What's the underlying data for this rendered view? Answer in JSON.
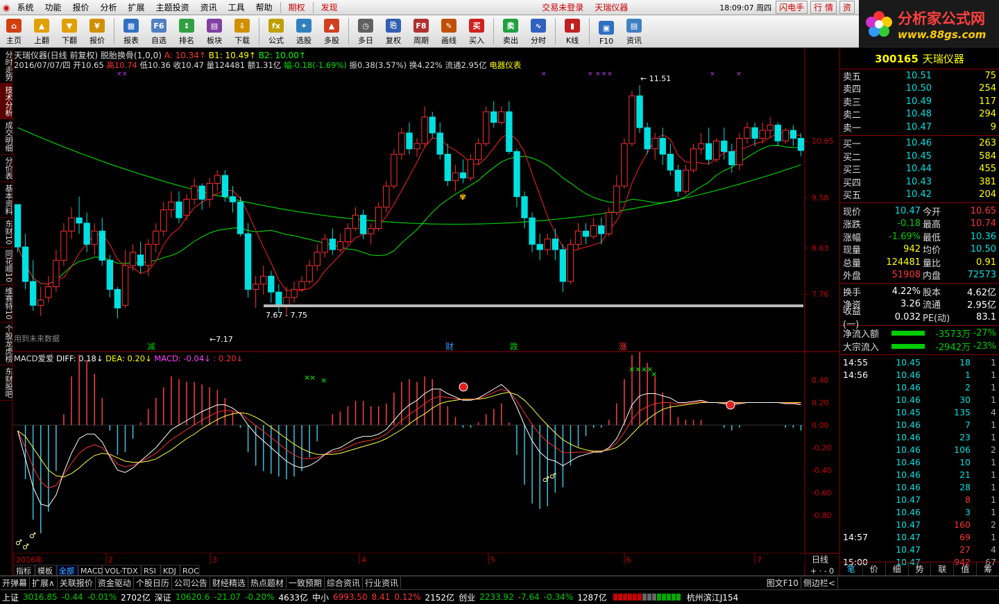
{
  "menu": {
    "items": [
      "系统",
      "功能",
      "报价",
      "分析",
      "扩展",
      "主题投资",
      "资讯",
      "工具",
      "帮助"
    ],
    "tab_qihuo": "期权",
    "tab_faxian": "发现",
    "login_status": "交易未登录",
    "stock_name_top": "天瑞仪器",
    "clock": "18:09:07 周四",
    "btn_flash": "闪电手",
    "btn_quote": "行 情",
    "btn_asset": "资"
  },
  "toolbar": [
    {
      "label": "主页",
      "icon": "home-icon",
      "color": "#d04010",
      "glyph": "⌂"
    },
    {
      "label": "上翻",
      "icon": "arrow-up-icon",
      "color": "#e0a000",
      "glyph": "▲"
    },
    {
      "label": "下翻",
      "icon": "arrow-down-icon",
      "color": "#e0a000",
      "glyph": "▼"
    },
    {
      "label": "报价",
      "icon": "price-icon",
      "color": "#d09000",
      "glyph": "¥"
    },
    {
      "label": "报表",
      "icon": "report-icon",
      "color": "#3070c0",
      "glyph": "▦"
    },
    {
      "label": "自选",
      "icon": "f6-icon",
      "color": "#5080c0",
      "glyph": "F6"
    },
    {
      "label": "排名",
      "icon": "rank-icon",
      "color": "#30a040",
      "glyph": "↕"
    },
    {
      "label": "板块",
      "icon": "sector-icon",
      "color": "#8040a0",
      "glyph": "▤"
    },
    {
      "label": "下载",
      "icon": "download-icon",
      "color": "#d09000",
      "glyph": "⇩"
    },
    {
      "label": "公式",
      "icon": "formula-icon",
      "color": "#c0a000",
      "glyph": "fx"
    },
    {
      "label": "选股",
      "icon": "pick-icon",
      "color": "#3080c0",
      "glyph": "✦"
    },
    {
      "label": "多股",
      "icon": "multi-icon",
      "color": "#d04020",
      "glyph": "▲"
    },
    {
      "label": "多日",
      "icon": "clock-icon",
      "color": "#606060",
      "glyph": "◷"
    },
    {
      "label": "复权",
      "icon": "restore-icon",
      "color": "#3060b0",
      "glyph": "⎘"
    },
    {
      "label": "周期",
      "icon": "f8-icon",
      "color": "#b03030",
      "glyph": "F8"
    },
    {
      "label": "画线",
      "icon": "draw-icon",
      "color": "#c05000",
      "glyph": "✎"
    },
    {
      "label": "买入",
      "icon": "buy-icon",
      "color": "#d02020",
      "glyph": "买"
    },
    {
      "label": "卖出",
      "icon": "sell-icon",
      "color": "#20a040",
      "glyph": "卖"
    },
    {
      "label": "分时",
      "icon": "intraday-icon",
      "color": "#3060c0",
      "glyph": "∿"
    },
    {
      "label": "K线",
      "icon": "kline-icon",
      "color": "#c02020",
      "glyph": "▮"
    },
    {
      "label": "F10",
      "icon": "f10-icon",
      "color": "#3070c0",
      "glyph": "▣"
    },
    {
      "label": "资讯",
      "icon": "news-icon",
      "color": "#4080c0",
      "glyph": "▤"
    }
  ],
  "logo": {
    "title": "分析家公式网",
    "url": "www.88gs.com"
  },
  "leftnav": [
    "分时走势",
    "技术分析",
    "成交明细",
    "分价表",
    "基本资料",
    "东财10",
    "同花顺10",
    "维赛特10",
    "个股龙虎榜",
    "东财股吧"
  ],
  "chart": {
    "header1": {
      "name": "天瑞仪器(日线 前复权)",
      "formula": "脱胎换骨(1,0,0)",
      "a": "A: 10.34",
      "b1": "B1: 10.49",
      "b2": "B2: 10.00"
    },
    "header2": {
      "date": "2016/07/07/四",
      "open": "开10.65",
      "high": "高10.74",
      "low": "低10.36",
      "close": "收10.47",
      "vol": "量124481",
      "amt": "额1.31亿",
      "chg": "幅-0.18(-1.69%)",
      "amp": "振0.38(3.57%)",
      "turn": "换4.22%",
      "float": "流通2.95亿",
      "industry": "电器仪表"
    },
    "price_labels": [
      "10.65",
      "9.58",
      "8.63",
      "7.76"
    ],
    "annot_high": "11.51",
    "annot_low": "7.17",
    "annot_range": "7.67 - 7.75",
    "future_note": "用到未来数据",
    "event_marks": [
      "减",
      "财",
      "跌",
      "涨"
    ],
    "macd_header": {
      "name": "MACD爱爱",
      "diff": "DIFF: 0.18",
      "dea": "DEA: 0.20",
      "macd": "MACD: -0.04",
      "last": ": 0.20"
    },
    "macd_labels": [
      "0.40",
      "0.20",
      "0.00",
      "-0.20",
      "-0.40",
      "-0.60",
      "-0.80"
    ],
    "date_labels": [
      "2016年",
      "2",
      "3",
      "4",
      "5",
      "6",
      "7"
    ],
    "period": "日线",
    "tabs": [
      "指标",
      "模板",
      "全部",
      "MACD",
      "VOL-TDX",
      "RSI",
      "KDJ",
      "ROC"
    ]
  },
  "chart_data": {
    "type": "candlestick",
    "title": "天瑞仪器(日线 前复权)",
    "ylim": [
      7.0,
      12.0
    ],
    "candles": [
      [
        9.45,
        9.45,
        8.65,
        8.55
      ],
      [
        8.65,
        8.9,
        8.0,
        7.85
      ],
      [
        8.0,
        8.4,
        7.55,
        7.45
      ],
      [
        7.55,
        7.9,
        7.65,
        7.35
      ],
      [
        7.7,
        8.1,
        7.9,
        7.6
      ],
      [
        7.9,
        8.6,
        8.4,
        7.8
      ],
      [
        8.4,
        9.1,
        8.95,
        8.3
      ],
      [
        8.95,
        9.4,
        9.2,
        8.8
      ],
      [
        9.2,
        9.6,
        9.1,
        8.9
      ],
      [
        9.1,
        9.3,
        8.7,
        8.55
      ],
      [
        8.7,
        9.1,
        8.95,
        8.5
      ],
      [
        8.95,
        9.2,
        8.4,
        8.3
      ],
      [
        8.4,
        8.5,
        7.85,
        7.7
      ],
      [
        7.85,
        7.9,
        7.5,
        7.3
      ],
      [
        7.55,
        8.6,
        8.3,
        7.5
      ],
      [
        8.3,
        8.7,
        8.55,
        8.2
      ],
      [
        8.5,
        8.75,
        8.3,
        8.15
      ],
      [
        8.3,
        8.8,
        8.7,
        8.1
      ],
      [
        8.7,
        9.1,
        8.95,
        8.55
      ],
      [
        8.95,
        9.5,
        9.35,
        8.85
      ],
      [
        9.35,
        9.7,
        9.5,
        9.2
      ],
      [
        9.5,
        9.7,
        9.2,
        9.1
      ],
      [
        9.25,
        9.65,
        9.55,
        9.15
      ],
      [
        9.55,
        9.95,
        9.8,
        9.45
      ],
      [
        9.8,
        9.85,
        9.55,
        9.35
      ],
      [
        9.55,
        9.95,
        9.85,
        9.4
      ],
      [
        9.85,
        10.1,
        10.0,
        9.7
      ],
      [
        10.0,
        10.1,
        9.6,
        9.5
      ],
      [
        9.6,
        9.8,
        9.5,
        9.3
      ],
      [
        9.5,
        9.6,
        8.9,
        8.85
      ],
      [
        8.9,
        9.1,
        7.85,
        7.7
      ],
      [
        7.85,
        8.1,
        7.95,
        7.5
      ],
      [
        7.95,
        8.3,
        8.1,
        7.75
      ],
      [
        8.1,
        8.2,
        7.8,
        7.6
      ],
      [
        7.8,
        7.95,
        7.55,
        7.4
      ],
      [
        7.55,
        7.9,
        7.7,
        7.35
      ],
      [
        7.7,
        8.0,
        7.85,
        7.6
      ],
      [
        7.85,
        8.1,
        8.0,
        7.8
      ],
      [
        8.0,
        8.4,
        8.3,
        7.95
      ],
      [
        8.3,
        8.7,
        8.55,
        8.2
      ],
      [
        8.55,
        8.9,
        8.8,
        8.45
      ],
      [
        8.8,
        9.0,
        8.6,
        8.5
      ],
      [
        8.6,
        8.9,
        8.75,
        8.55
      ],
      [
        8.75,
        9.1,
        9.0,
        8.7
      ],
      [
        9.0,
        9.4,
        9.25,
        8.95
      ],
      [
        9.25,
        9.35,
        8.9,
        8.8
      ],
      [
        8.9,
        9.1,
        9.0,
        8.7
      ],
      [
        9.0,
        9.5,
        9.4,
        8.95
      ],
      [
        9.4,
        9.9,
        9.8,
        9.3
      ],
      [
        9.8,
        10.5,
        10.4,
        9.75
      ],
      [
        10.4,
        10.9,
        10.8,
        10.3
      ],
      [
        10.8,
        11.0,
        10.5,
        10.4
      ],
      [
        10.5,
        10.7,
        10.6,
        10.35
      ],
      [
        10.6,
        11.3,
        11.1,
        10.55
      ],
      [
        11.1,
        11.2,
        10.8,
        10.7
      ],
      [
        10.8,
        11.0,
        10.4,
        10.3
      ],
      [
        10.4,
        10.6,
        9.9,
        9.8
      ],
      [
        9.9,
        10.2,
        10.05,
        9.7
      ],
      [
        10.05,
        10.3,
        9.95,
        9.85
      ],
      [
        9.95,
        10.4,
        10.3,
        9.9
      ],
      [
        10.3,
        10.7,
        10.6,
        10.2
      ],
      [
        10.6,
        11.3,
        11.2,
        10.55
      ],
      [
        11.2,
        11.4,
        11.0,
        10.9
      ],
      [
        11.0,
        11.3,
        11.2,
        10.95
      ],
      [
        11.2,
        11.4,
        10.45,
        10.4
      ],
      [
        10.45,
        10.5,
        9.6,
        9.4
      ],
      [
        9.6,
        9.7,
        9.2,
        9.0
      ],
      [
        9.2,
        9.3,
        8.7,
        8.55
      ],
      [
        8.7,
        8.9,
        8.6,
        8.4
      ],
      [
        8.6,
        8.9,
        8.8,
        8.5
      ],
      [
        8.8,
        9.0,
        8.6,
        8.4
      ],
      [
        8.6,
        8.7,
        8.0,
        7.8
      ],
      [
        8.0,
        8.8,
        8.7,
        7.95
      ],
      [
        8.7,
        9.1,
        8.95,
        8.6
      ],
      [
        8.95,
        9.1,
        8.85,
        8.7
      ],
      [
        8.85,
        9.2,
        9.05,
        8.8
      ],
      [
        9.05,
        9.2,
        8.9,
        8.7
      ],
      [
        8.9,
        9.4,
        9.3,
        8.85
      ],
      [
        9.3,
        10.0,
        9.8,
        9.25
      ],
      [
        9.8,
        10.7,
        10.6,
        9.75
      ],
      [
        10.6,
        11.6,
        11.5,
        10.55
      ],
      [
        11.5,
        11.7,
        10.9,
        10.8
      ],
      [
        10.9,
        11.0,
        10.5,
        10.4
      ],
      [
        10.5,
        10.8,
        10.7,
        10.3
      ],
      [
        10.7,
        10.9,
        10.4,
        10.2
      ],
      [
        10.4,
        10.6,
        10.1,
        10.0
      ],
      [
        10.1,
        10.2,
        9.7,
        9.6
      ],
      [
        9.7,
        10.2,
        10.1,
        9.65
      ],
      [
        10.1,
        10.6,
        10.5,
        10.05
      ],
      [
        10.5,
        10.8,
        10.6,
        10.4
      ],
      [
        10.6,
        10.9,
        10.3,
        10.2
      ],
      [
        10.3,
        10.7,
        10.65,
        10.25
      ],
      [
        10.65,
        10.9,
        10.45,
        10.3
      ],
      [
        10.45,
        10.6,
        10.2,
        10.05
      ],
      [
        10.2,
        10.8,
        10.7,
        10.1
      ],
      [
        10.7,
        11.0,
        10.9,
        10.6
      ],
      [
        10.9,
        11.0,
        10.7,
        10.55
      ],
      [
        10.7,
        11.0,
        10.85,
        10.6
      ],
      [
        10.85,
        11.1,
        10.95,
        10.7
      ],
      [
        10.95,
        11.0,
        10.65,
        10.55
      ],
      [
        10.65,
        10.9,
        10.85,
        10.6
      ],
      [
        10.85,
        10.95,
        10.7,
        10.55
      ],
      [
        10.7,
        10.8,
        10.47,
        10.36
      ]
    ],
    "macd": {
      "diff": [
        -0.05,
        -0.3,
        -0.55,
        -0.7,
        -0.72,
        -0.62,
        -0.42,
        -0.25,
        -0.12,
        -0.08,
        -0.08,
        -0.15,
        -0.28,
        -0.4,
        -0.42,
        -0.38,
        -0.32,
        -0.26,
        -0.2,
        -0.12,
        -0.04,
        0.0,
        0.04,
        0.08,
        0.12,
        0.15,
        0.18,
        0.18,
        0.15,
        0.1,
        0.0,
        -0.08,
        -0.14,
        -0.2,
        -0.26,
        -0.32,
        -0.36,
        -0.38,
        -0.36,
        -0.32,
        -0.26,
        -0.22,
        -0.2,
        -0.16,
        -0.12,
        -0.1,
        -0.1,
        -0.08,
        -0.04,
        0.04,
        0.12,
        0.18,
        0.22,
        0.28,
        0.32,
        0.32,
        0.28,
        0.25,
        0.22,
        0.22,
        0.24,
        0.28,
        0.32,
        0.36,
        0.3,
        0.16,
        0.0,
        -0.14,
        -0.24,
        -0.3,
        -0.32,
        -0.36,
        -0.32,
        -0.28,
        -0.26,
        -0.24,
        -0.24,
        -0.2,
        -0.12,
        0.02,
        0.18,
        0.26,
        0.28,
        0.28,
        0.26,
        0.24,
        0.2,
        0.2,
        0.21,
        0.22,
        0.2,
        0.2,
        0.19,
        0.18,
        0.19,
        0.2,
        0.2,
        0.2,
        0.2,
        0.2,
        0.19,
        0.19,
        0.18
      ],
      "dea": [
        -0.05,
        -0.1,
        -0.2,
        -0.3,
        -0.4,
        -0.45,
        -0.46,
        -0.43,
        -0.38,
        -0.32,
        -0.27,
        -0.25,
        -0.26,
        -0.29,
        -0.32,
        -0.33,
        -0.33,
        -0.32,
        -0.3,
        -0.26,
        -0.22,
        -0.17,
        -0.12,
        -0.08,
        -0.03,
        0.01,
        0.05,
        0.08,
        0.1,
        0.11,
        0.1,
        0.07,
        0.03,
        -0.02,
        -0.07,
        -0.12,
        -0.17,
        -0.21,
        -0.24,
        -0.26,
        -0.26,
        -0.26,
        -0.25,
        -0.23,
        -0.21,
        -0.19,
        -0.17,
        -0.15,
        -0.12,
        -0.08,
        -0.04,
        0.01,
        0.06,
        0.1,
        0.15,
        0.19,
        0.21,
        0.22,
        0.23,
        0.23,
        0.23,
        0.24,
        0.26,
        0.28,
        0.29,
        0.27,
        0.22,
        0.15,
        0.07,
        0.0,
        -0.07,
        -0.13,
        -0.17,
        -0.2,
        -0.22,
        -0.23,
        -0.23,
        -0.22,
        -0.2,
        -0.15,
        -0.08,
        -0.01,
        0.05,
        0.1,
        0.14,
        0.16,
        0.17,
        0.18,
        0.19,
        0.2,
        0.2,
        0.2,
        0.2,
        0.2,
        0.2,
        0.2,
        0.2,
        0.2,
        0.2,
        0.2,
        0.2,
        0.2,
        0.2
      ]
    }
  },
  "quote": {
    "code": "300165",
    "name": "天瑞仪器",
    "asks": [
      {
        "l": "卖五",
        "p": "10.51",
        "v": "75"
      },
      {
        "l": "卖四",
        "p": "10.50",
        "v": "254"
      },
      {
        "l": "卖三",
        "p": "10.49",
        "v": "117"
      },
      {
        "l": "卖二",
        "p": "10.48",
        "v": "294"
      },
      {
        "l": "卖一",
        "p": "10.47",
        "v": "9"
      }
    ],
    "bids": [
      {
        "l": "买一",
        "p": "10.46",
        "v": "263"
      },
      {
        "l": "买二",
        "p": "10.45",
        "v": "584"
      },
      {
        "l": "买三",
        "p": "10.44",
        "v": "455"
      },
      {
        "l": "买四",
        "p": "10.43",
        "v": "381"
      },
      {
        "l": "买五",
        "p": "10.42",
        "v": "204"
      }
    ],
    "stats": [
      {
        "l1": "现价",
        "v1": "10.47",
        "l2": "今开",
        "v2": "10.65"
      },
      {
        "l1": "涨跌",
        "v1": "-0.18",
        "l2": "最高",
        "v2": "10.74"
      },
      {
        "l1": "涨幅",
        "v1": "-1.69%",
        "l2": "最低",
        "v2": "10.36"
      },
      {
        "l1": "现量",
        "v1": "942",
        "l2": "均价",
        "v2": "10.50"
      },
      {
        "l1": "总量",
        "v1": "124481",
        "l2": "量比",
        "v2": "0.91"
      },
      {
        "l1": "外盘",
        "v1": "51908",
        "l2": "内盘",
        "v2": "72573"
      }
    ],
    "stats2": [
      {
        "l1": "换手",
        "v1": "4.22%",
        "l2": "股本",
        "v2": "4.62亿"
      },
      {
        "l1": "净资",
        "v1": "3.26",
        "l2": "流通",
        "v2": "2.95亿"
      },
      {
        "l1": "收益(一)",
        "v1": "0.032",
        "l2": "PE(动)",
        "v2": "83.1"
      }
    ],
    "flows": [
      {
        "l": "净流入额",
        "v": "-3573万",
        "p": "-27%"
      },
      {
        "l": "大宗流入",
        "v": "-2942万",
        "p": "-23%"
      }
    ],
    "ticks": [
      [
        "14:55",
        "10.45",
        "18",
        "1"
      ],
      [
        "14:56",
        "10.46",
        "1",
        "1"
      ],
      [
        "",
        "10.46",
        "2",
        "1"
      ],
      [
        "",
        "10.46",
        "30",
        "1"
      ],
      [
        "",
        "10.45",
        "135",
        "4"
      ],
      [
        "",
        "10.46",
        "7",
        "1"
      ],
      [
        "",
        "10.46",
        "23",
        "1"
      ],
      [
        "",
        "10.46",
        "106",
        "2"
      ],
      [
        "",
        "10.46",
        "10",
        "1"
      ],
      [
        "",
        "10.46",
        "21",
        "1"
      ],
      [
        "",
        "10.46",
        "28",
        "1"
      ],
      [
        "",
        "10.47",
        "8",
        "1"
      ],
      [
        "",
        "10.46",
        "3",
        "1"
      ],
      [
        "",
        "10.47",
        "160",
        "2"
      ],
      [
        "14:57",
        "10.47",
        "69",
        "1"
      ],
      [
        "",
        "10.47",
        "27",
        "4"
      ],
      [
        "15:00",
        "10.47",
        "942",
        "67"
      ]
    ],
    "tabs": [
      "笔",
      "价",
      "细",
      "势",
      "联",
      "值",
      "筹"
    ]
  },
  "bottom_tabs": [
    "开弹幕",
    "扩展∧",
    "关联报价",
    "资金驱动",
    "个股日历",
    "公司公告",
    "财经精选",
    "热点题材",
    "一致预期",
    "综合资讯",
    "行业资讯"
  ],
  "bottom_right": [
    "图文F10",
    "侧边栏<"
  ],
  "status": {
    "sh": "上证",
    "sh_v": "3016.85",
    "sh_c": "-0.44",
    "sh_p": "-0.01%",
    "sh_a": "2702亿",
    "sz": "深证",
    "sz_v": "10620.6",
    "sz_c": "-21.07",
    "sz_p": "-0.20%",
    "sz_a": "4633亿",
    "zx": "中小",
    "zx_v": "6993.50",
    "zx_c": "8.41",
    "zx_p": "0.12%",
    "zx_a": "2152亿",
    "cy": "创业",
    "cy_v": "2233.92",
    "cy_c": "-7.64",
    "cy_p": "-0.34%",
    "cy_a": "1287亿",
    "loc": "杭州滨江J154"
  }
}
